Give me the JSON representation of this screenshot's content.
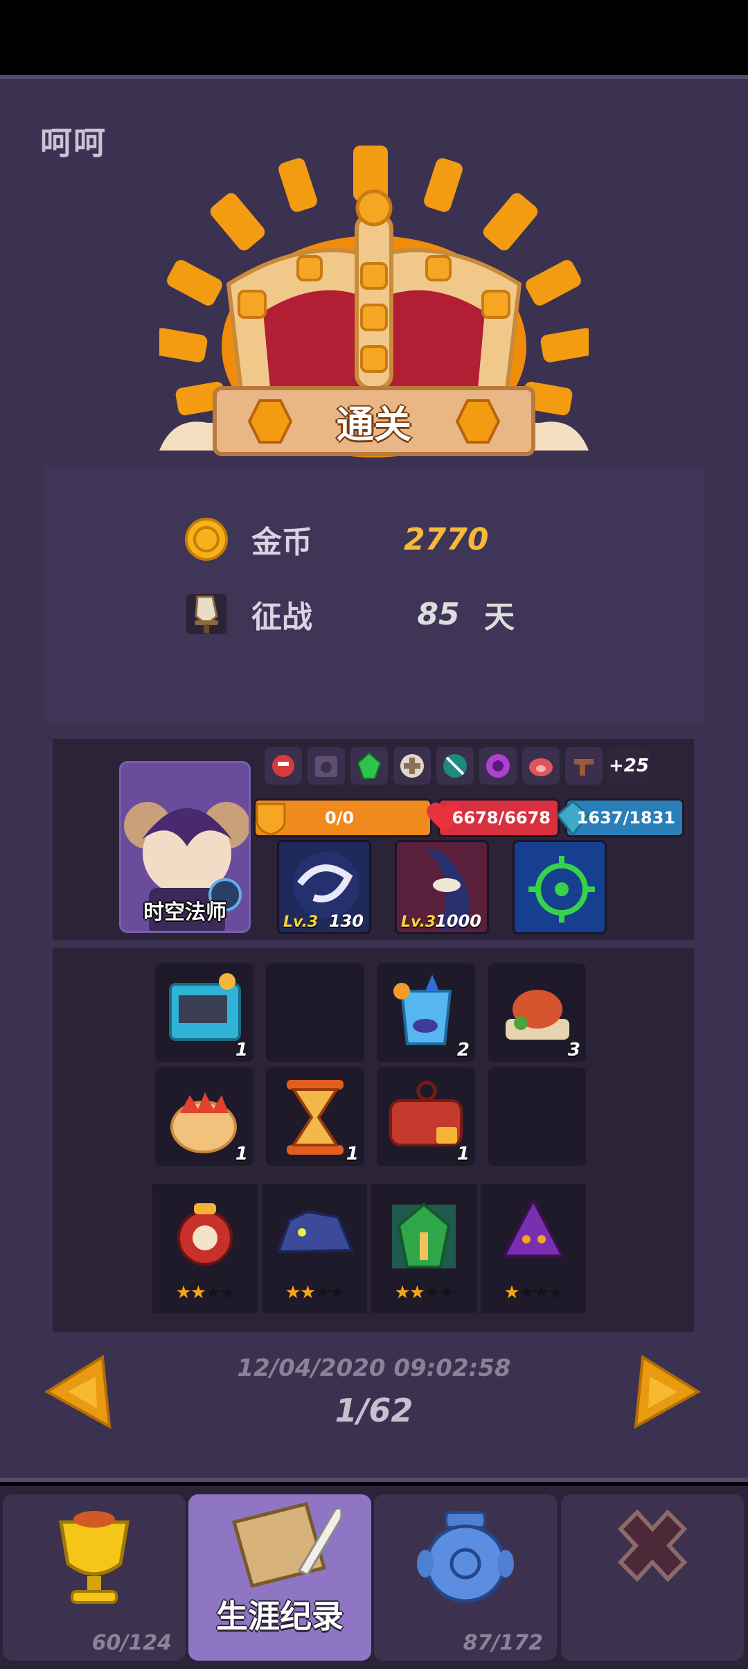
{
  "player": {
    "name": "呵呵"
  },
  "result": {
    "banner": "通关"
  },
  "summary": {
    "gold_label": "金币",
    "gold_value": "2770",
    "campaign_label": "征战",
    "campaign_days": "85",
    "campaign_unit": "天"
  },
  "hero": {
    "name": "时空法师",
    "relics_more": "+25",
    "shield": "0/0",
    "hp": "6678/6678",
    "mana": "1637/1831",
    "skills": [
      {
        "level": "Lv.3",
        "value": "130"
      },
      {
        "level": "Lv.3",
        "value": "1000"
      },
      {
        "level": "",
        "value": ""
      }
    ]
  },
  "items": [
    {
      "count": "1"
    },
    {
      "count": ""
    },
    {
      "count": "2"
    },
    {
      "count": "3"
    },
    {
      "count": "1"
    },
    {
      "count": "1"
    },
    {
      "count": "1"
    },
    {
      "count": ""
    }
  ],
  "pets": [
    {
      "stars": 2
    },
    {
      "stars": 2
    },
    {
      "stars": 2
    },
    {
      "stars": 1
    }
  ],
  "record": {
    "datetime": "12/04/2020 09:02:58",
    "page": "1/62"
  },
  "tabs": [
    {
      "count": "60/124",
      "label": ""
    },
    {
      "count": "",
      "label": "生涯纪录"
    },
    {
      "count": "87/172",
      "label": ""
    },
    {
      "count": "",
      "label": ""
    }
  ],
  "colors": {
    "panel": "#3b3150",
    "accent_orange": "#f39c12",
    "active_tab": "#8e76c4",
    "gold_text": "#f6b93b"
  }
}
